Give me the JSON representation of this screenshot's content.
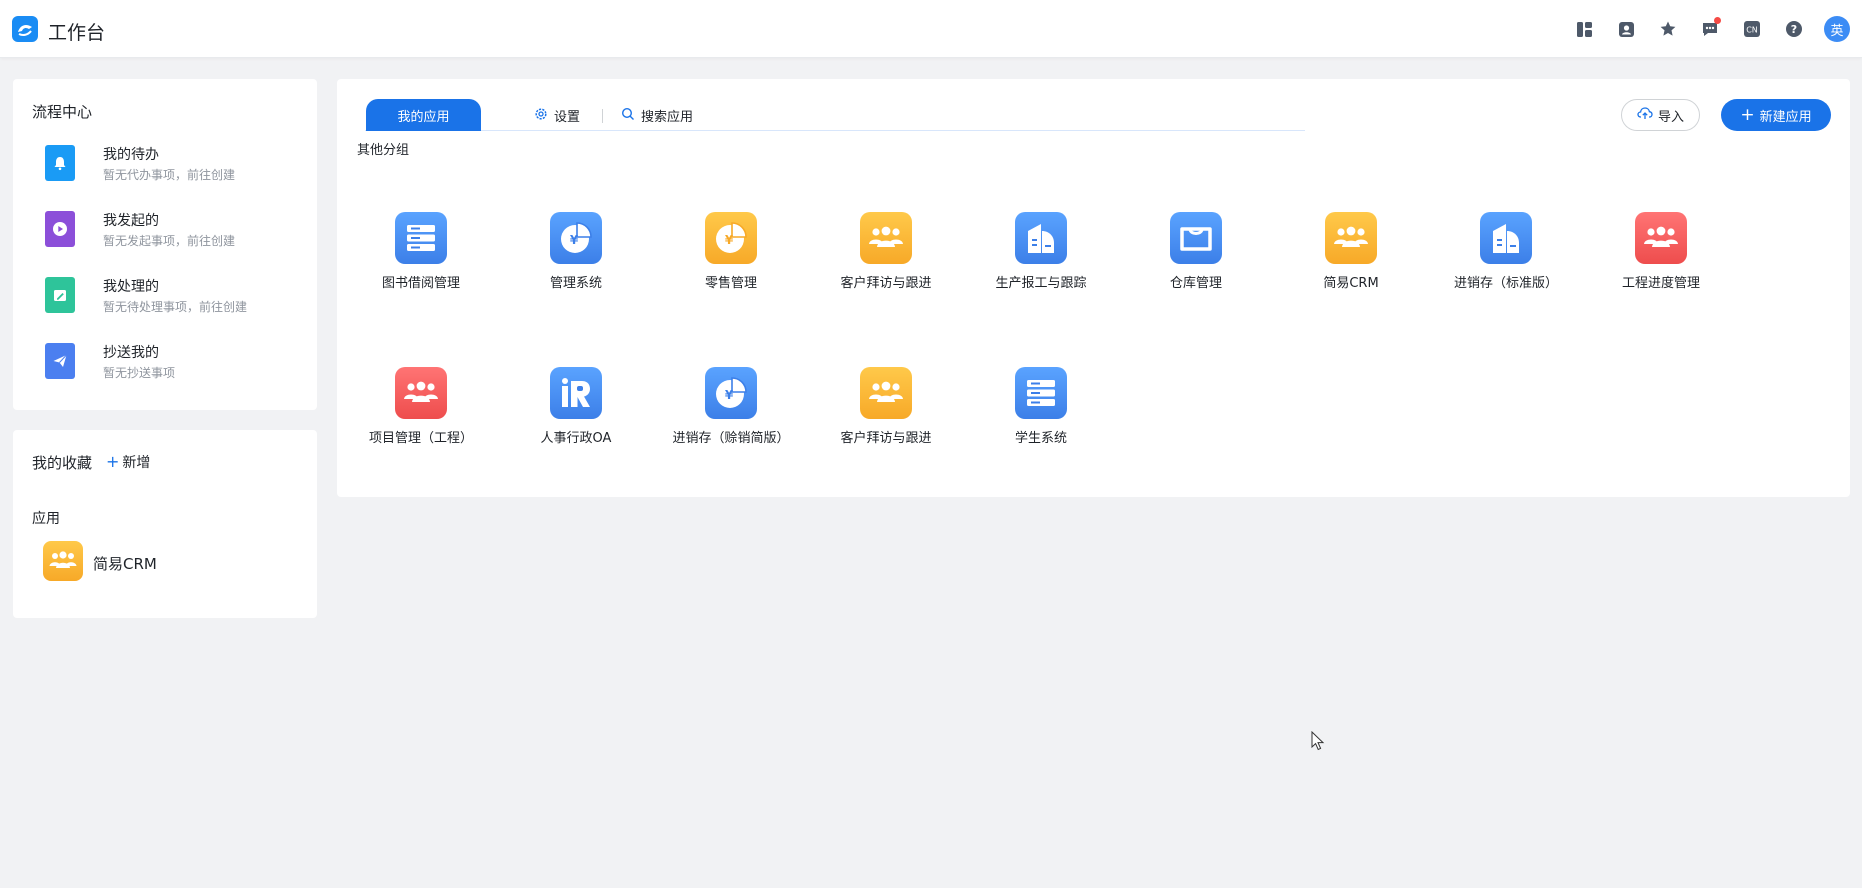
{
  "header": {
    "title": "工作台",
    "icons": [
      "layout-icon",
      "contacts-icon",
      "star-icon",
      "message-icon",
      "language-icon",
      "help-icon"
    ],
    "language_badge": "CN",
    "help_glyph": "?",
    "avatar_text": "英"
  },
  "flow_center": {
    "title": "流程中心",
    "items": [
      {
        "title": "我的待办",
        "subtitle": "暂无代办事项，前往创建",
        "icon": "bell-icon",
        "color": "#1a9bf5"
      },
      {
        "title": "我发起的",
        "subtitle": "暂无发起事项，前往创建",
        "icon": "play-icon",
        "color": "#8c4fd9"
      },
      {
        "title": "我处理的",
        "subtitle": "暂无待处理事项，前往创建",
        "icon": "edit-icon",
        "color": "#2ec49a"
      },
      {
        "title": "抄送我的",
        "subtitle": "暂无抄送事项",
        "icon": "send-icon",
        "color": "#4b7ff0"
      }
    ]
  },
  "favorites": {
    "title": "我的收藏",
    "add_label": "新增",
    "section_label": "应用",
    "apps": [
      {
        "name": "简易CRM",
        "icon": "people-icon",
        "color": "#f7b32e"
      }
    ]
  },
  "main": {
    "tabs": {
      "active": "我的应用",
      "settings": "设置",
      "search": "搜索应用"
    },
    "import_label": "导入",
    "new_app_label": "新建应用",
    "group_label": "其他分组",
    "apps": [
      {
        "name": "图书借阅管理",
        "icon": "database-icon",
        "color": "blue"
      },
      {
        "name": "管理系统",
        "icon": "pie-yuan-icon",
        "color": "blue"
      },
      {
        "name": "零售管理",
        "icon": "pie-yuan-icon",
        "color": "orange"
      },
      {
        "name": "客户拜访与跟进",
        "icon": "people-icon",
        "color": "orange"
      },
      {
        "name": "生产报工与跟踪",
        "icon": "building-icon",
        "color": "blue"
      },
      {
        "name": "仓库管理",
        "icon": "warehouse-icon",
        "color": "blue"
      },
      {
        "name": "简易CRM",
        "icon": "people-icon",
        "color": "orange"
      },
      {
        "name": "进销存（标准版）",
        "icon": "building-icon",
        "color": "blue"
      },
      {
        "name": "工程进度管理",
        "icon": "people-icon",
        "color": "red"
      },
      {
        "name": "项目管理（工程）",
        "icon": "people-icon",
        "color": "red"
      },
      {
        "name": "人事行政OA",
        "icon": "hr-icon",
        "color": "blue"
      },
      {
        "name": "进销存（赊销简版）",
        "icon": "pie-yuan-icon",
        "color": "blue"
      },
      {
        "name": "客户拜访与跟进",
        "icon": "people-icon",
        "color": "orange"
      },
      {
        "name": "学生系统",
        "icon": "database-icon",
        "color": "blue"
      }
    ]
  }
}
